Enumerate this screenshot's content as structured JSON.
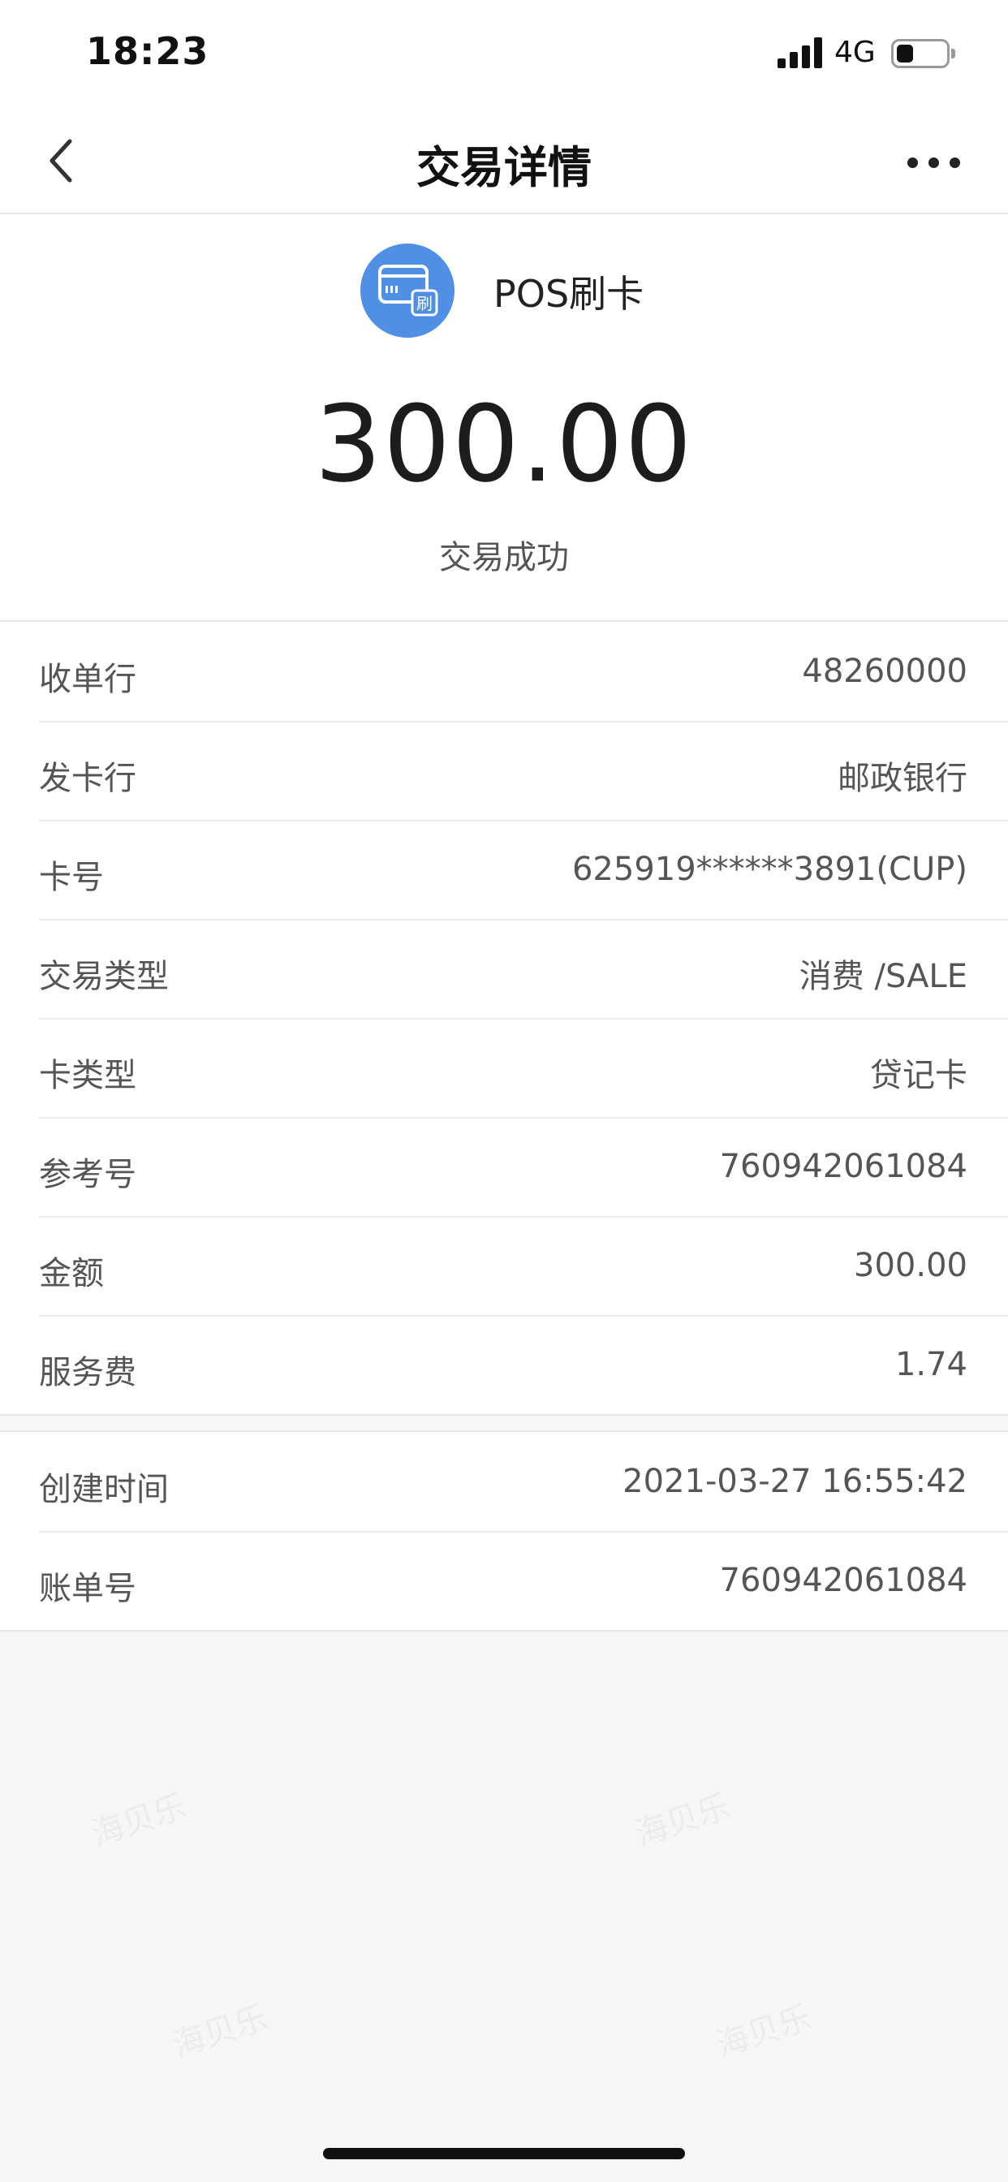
{
  "status_bar": {
    "time": "18:23",
    "network": "4G",
    "battery_level": 0.35,
    "icons": [
      "signal-icon",
      "battery-icon"
    ]
  },
  "nav": {
    "title": "交易详情",
    "icons": [
      "back-chevron-icon",
      "more-dots-icon"
    ]
  },
  "header": {
    "icon": "card-swipe-icon",
    "icon_text": "刷",
    "icon_color": "#4f8fe4",
    "type_label": "POS刷卡",
    "amount": "300.00",
    "status": "交易成功"
  },
  "details": [
    {
      "label": "收单行",
      "value": "48260000"
    },
    {
      "label": "发卡行",
      "value": "邮政银行"
    },
    {
      "label": "卡号",
      "value": "625919******3891(CUP)"
    },
    {
      "label": "交易类型",
      "value": "消费 /SALE"
    },
    {
      "label": "卡类型",
      "value": "贷记卡"
    },
    {
      "label": "参考号",
      "value": "760942061084"
    },
    {
      "label": "金额",
      "value": "300.00"
    },
    {
      "label": "服务费",
      "value": "1.74"
    }
  ],
  "meta": [
    {
      "label": "创建时间",
      "value": "2021-03-27 16:55:42"
    },
    {
      "label": "账单号",
      "value": "760942061084"
    }
  ],
  "watermark": {
    "text": "海贝乐"
  }
}
